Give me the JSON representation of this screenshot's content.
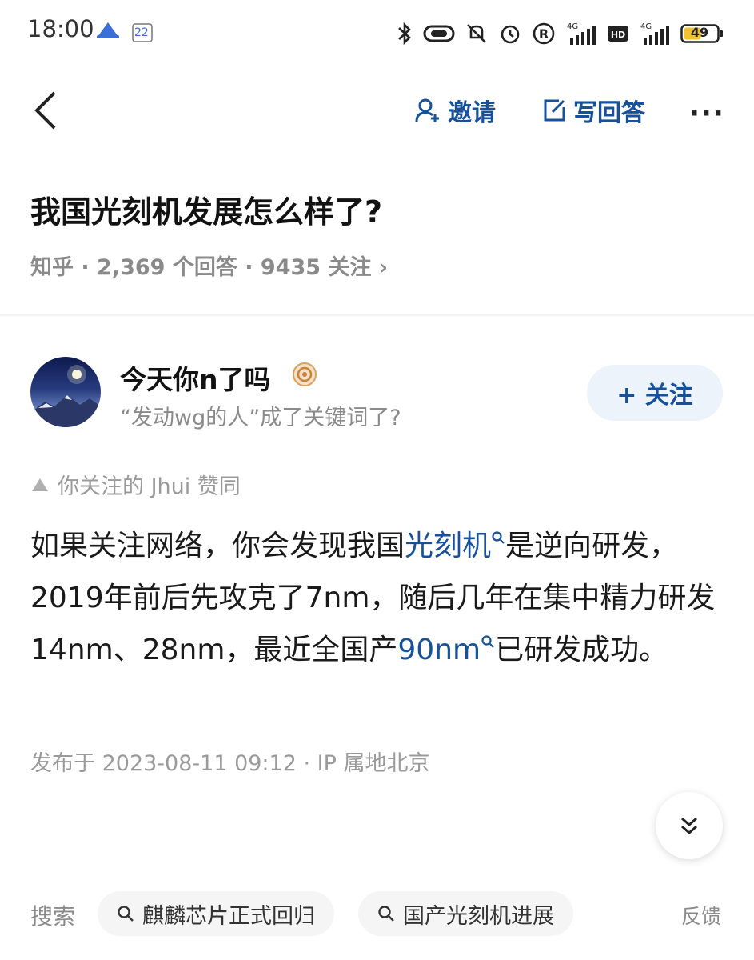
{
  "status_bar": {
    "time": "18:00",
    "calendar_badge": "22",
    "battery": "49"
  },
  "header": {
    "invite_label": "邀请",
    "write_answer_label": "写回答",
    "more_label": "···"
  },
  "question": {
    "title": "我国光刻机发展怎么样了?",
    "meta": "知乎 · 2,369 个回答 · 9435 关注 ›"
  },
  "author": {
    "name": "今天你n了吗",
    "bio": "“发动wg的人”成了关键词了?",
    "follow_label": "+ 关注"
  },
  "endorse": {
    "text": "你关注的 Jhui 赞同"
  },
  "answer": {
    "part1": "如果关注网络，你会发现我国",
    "keyword1": "光刻机",
    "part2": "是逆向研发，2019年前后先攻克了7nm，随后几年在集中精力研发14nm、28nm，最近全国产",
    "keyword2": "90nm",
    "part3": "已研发成功。"
  },
  "publish_info": "发布于 2023-08-11 09:12 · IP 属地北京",
  "search_bar": {
    "label": "搜索",
    "chips": [
      "麒麟芯片正式回归",
      "国产光刻机进展"
    ],
    "feedback_label": "反馈"
  },
  "colors": {
    "link_blue": "#175199",
    "follow_bg": "#edf3fb",
    "muted_text": "#8a8a8a"
  },
  "icons": {
    "back": "chevron-left-icon",
    "invite": "add-user-icon",
    "write": "edit-icon",
    "expand": "double-chevron-down-icon",
    "search": "search-icon"
  }
}
